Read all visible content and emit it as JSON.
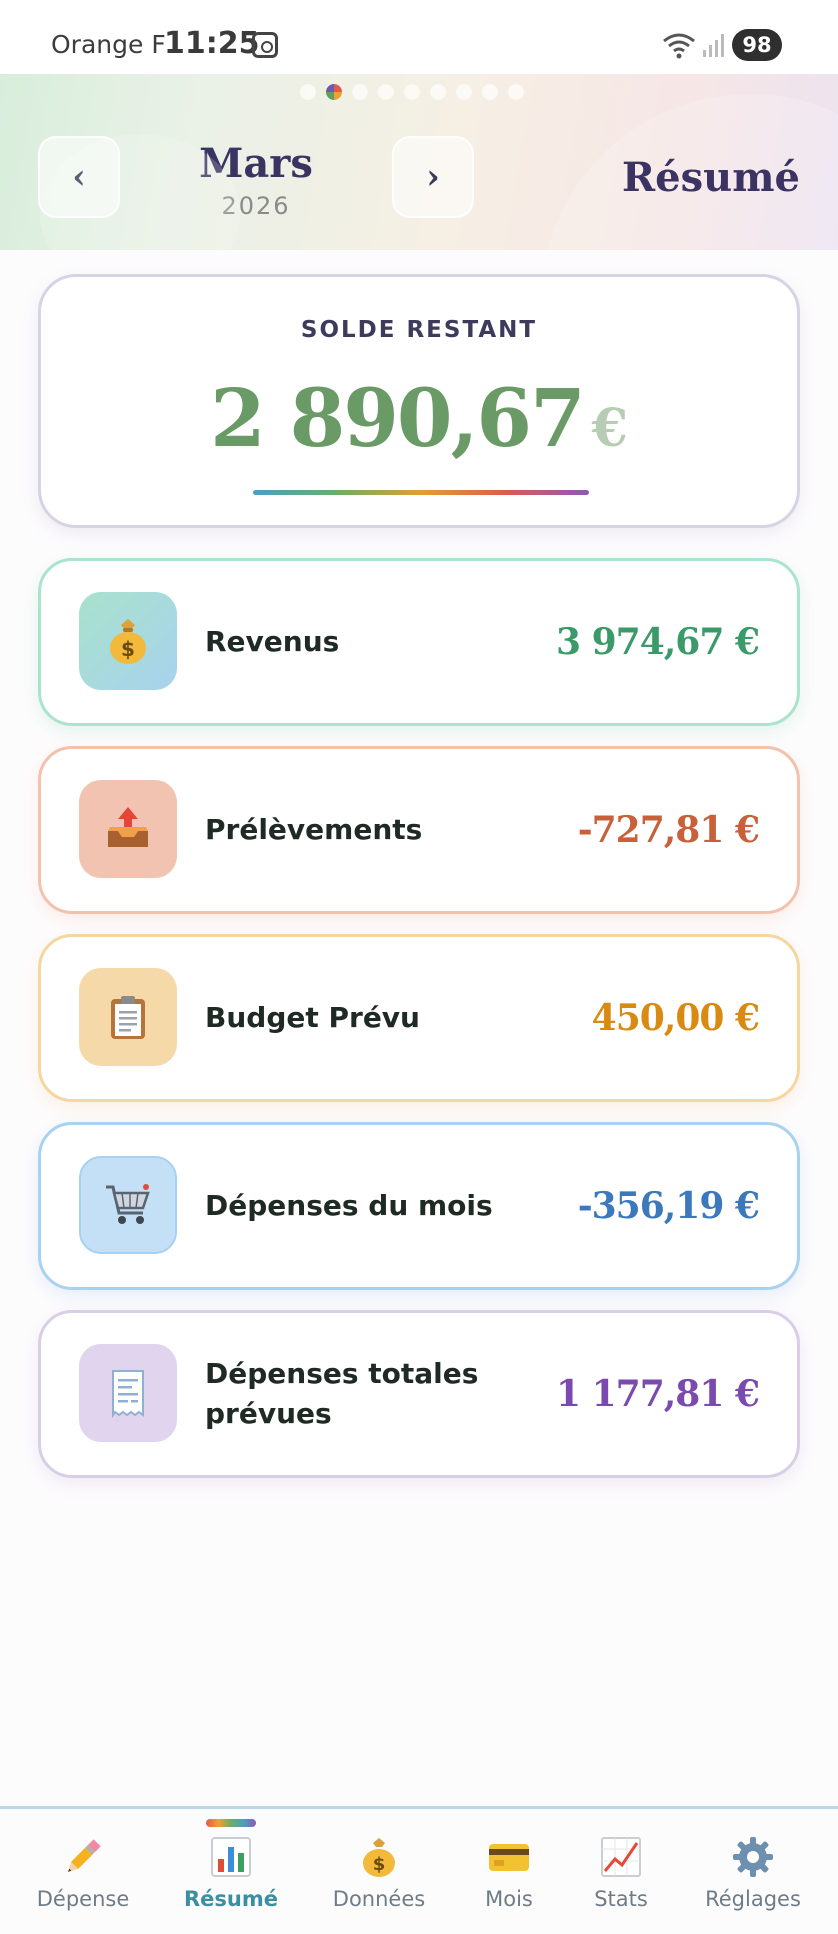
{
  "status_bar": {
    "carrier": "Orange F",
    "time": "11:25",
    "battery": "98"
  },
  "header": {
    "month": "Mars",
    "year": "2026",
    "prev_symbol": "‹",
    "next_symbol": "›",
    "title": "Résumé",
    "page_count": 9,
    "active_page": 2
  },
  "balance": {
    "label": "SOLDE RESTANT",
    "amount": "2 890,67",
    "currency": "€"
  },
  "summary": [
    {
      "key": "revenus",
      "label": "Revenus",
      "value": "3 974,67 €",
      "icon": "money-bag-icon",
      "color": "#3b9a6a"
    },
    {
      "key": "prelevements",
      "label": "Prélèvements",
      "value": "-727,81 €",
      "icon": "outbox-tray-icon",
      "color": "#c8603a"
    },
    {
      "key": "budget",
      "label": "Budget Prévu",
      "value": "450,00 €",
      "icon": "clipboard-icon",
      "color": "#d98a12"
    },
    {
      "key": "depenses",
      "label": "Dépenses du mois",
      "value": "-356,19 €",
      "icon": "shopping-cart-icon",
      "color": "#3c78bc"
    },
    {
      "key": "totales",
      "label": "Dépenses totales prévues",
      "value": "1 177,81 €",
      "icon": "receipt-icon",
      "color": "#7a4aae"
    }
  ],
  "bottom_nav": [
    {
      "label": "Dépense",
      "icon": "pencil-icon",
      "active": false
    },
    {
      "label": "Résumé",
      "icon": "bar-chart-icon",
      "active": true
    },
    {
      "label": "Données",
      "icon": "money-bag-icon",
      "active": false
    },
    {
      "label": "Mois",
      "icon": "credit-card-icon",
      "active": false
    },
    {
      "label": "Stats",
      "icon": "trend-chart-icon",
      "active": false
    },
    {
      "label": "Réglages",
      "icon": "gear-icon",
      "active": false
    }
  ]
}
